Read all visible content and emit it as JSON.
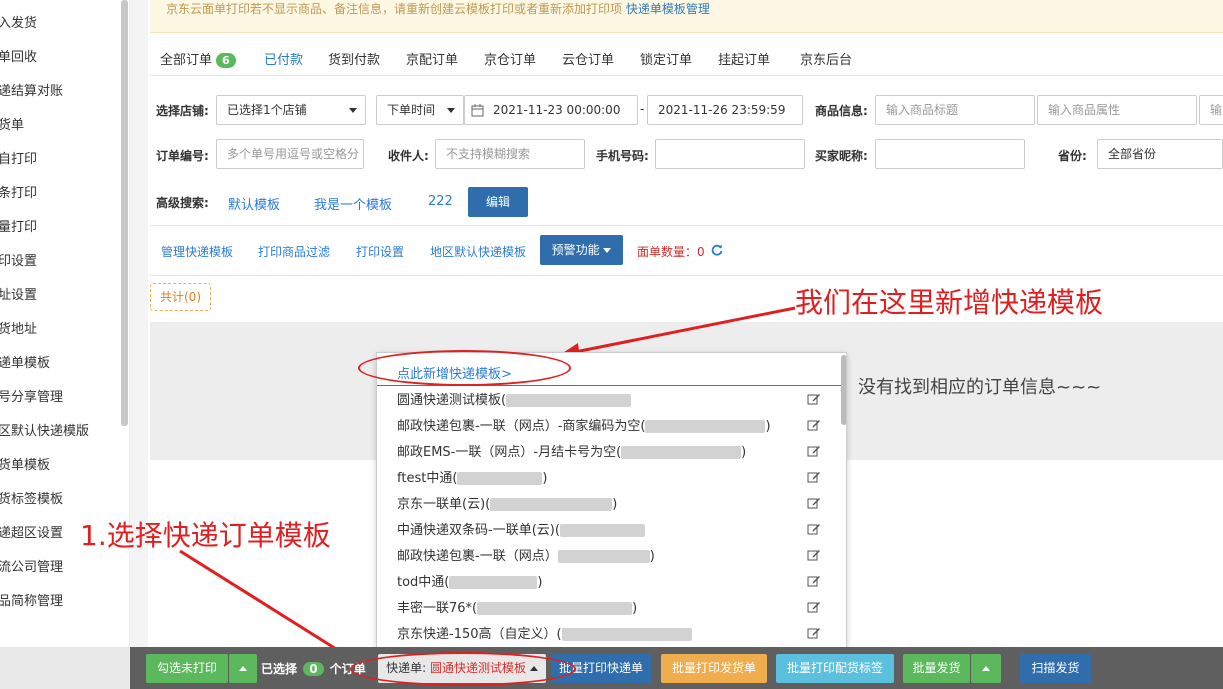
{
  "sidebar": {
    "items": [
      "入发货",
      "单回收",
      "递结算对账",
      "货单",
      "自打印",
      "条打印",
      "量打印",
      "印设置",
      "址设置",
      "货地址",
      "递单模板",
      "号分享管理",
      "区默认快递模版",
      "货单模板",
      "货标签模板",
      "递超区设置",
      "流公司管理",
      "品简称管理"
    ]
  },
  "notice": {
    "text": "京东云面单打印若不显示商品、备注信息，请重新创建云模板打印或者重新添加打印项",
    "link": "快递单模板管理"
  },
  "tabs": [
    {
      "label": "全部订单",
      "badge": "6"
    },
    {
      "label": "已付款"
    },
    {
      "label": "货到付款"
    },
    {
      "label": "京配订单"
    },
    {
      "label": "京仓订单"
    },
    {
      "label": "云仓订单"
    },
    {
      "label": "锁定订单"
    },
    {
      "label": "挂起订单"
    },
    {
      "label": "京东后台"
    }
  ],
  "filters": {
    "shop_label": "选择店铺:",
    "shop_value": "已选择1个店铺",
    "time_type": "下单时间",
    "date_start": "2021-11-23 00:00:00",
    "date_dash": "-",
    "date_end": "2021-11-26 23:59:59",
    "product_label": "商品信息:",
    "product_title_ph": "输入商品标题",
    "product_attr_ph": "输入商品属性",
    "product_extra_ph": "输入",
    "order_no_label": "订单编号:",
    "order_no_ph": "多个单号用逗号或空格分",
    "receiver_label": "收件人:",
    "receiver_ph": "不支持模糊搜索",
    "phone_label": "手机号码:",
    "buyer_label": "买家昵称:",
    "province_label": "省份:",
    "province_value": "全部省份"
  },
  "advanced": {
    "label": "高级搜索:",
    "presets": [
      "默认模板",
      "我是一个模板",
      "222"
    ],
    "edit_btn": "编辑"
  },
  "toolbar": {
    "links": [
      "管理快递模板",
      "打印商品过滤",
      "打印设置",
      "地区默认快递模板"
    ],
    "warning_btn": "预警功能",
    "count_label": "面单数量：",
    "count_value": "0"
  },
  "total_chip": "共计(0)",
  "empty_message": "没有找到相应的订单信息~~~",
  "dropdown": {
    "add_label": "点此新增快递模板>",
    "items": [
      {
        "text": "圆通快递测试模板(",
        "tail": ""
      },
      {
        "text": "邮政快递包裹-一联（网点）-商家编码为空(",
        "tail": ")"
      },
      {
        "text": "邮政EMS-一联（网点）-月结卡号为空(",
        "tail": ")"
      },
      {
        "text": "ftest中通(",
        "tail": ")"
      },
      {
        "text": "京东一联单(云)(",
        "tail": ")"
      },
      {
        "text": "中通快递双条码-一联单(云)(",
        "tail": ""
      },
      {
        "text": "邮政快递包裹-一联（网点）",
        "tail": ")"
      },
      {
        "text": "tod中通(",
        "tail": ")"
      },
      {
        "text": "丰密一联76*(",
        "tail": ")"
      },
      {
        "text": "京东快递-150高（自定义）(",
        "tail": ""
      }
    ]
  },
  "annotations": {
    "top": "我们在这里新增快递模板",
    "bottom": "1.选择快递订单模板"
  },
  "bottom": {
    "select_unprinted": "勾选未打印",
    "selected_prefix": "已选择",
    "selected_count": "0",
    "selected_suffix": "个订单",
    "express_label": "快递单:",
    "express_value": "圆通快递测试模板",
    "batch_print_express": "批量打印快递单",
    "batch_print_invoice": "批量打印发货单",
    "batch_print_label": "批量打印配货标签",
    "batch_ship": "批量发货",
    "scan_ship": "扫描发货"
  },
  "colors": {
    "accent": "#2b7cd3",
    "annotation": "#e02020",
    "green": "#5cb85c",
    "orange": "#f0ad4e",
    "cyan": "#5bc0de",
    "navy": "#2f6dac"
  }
}
